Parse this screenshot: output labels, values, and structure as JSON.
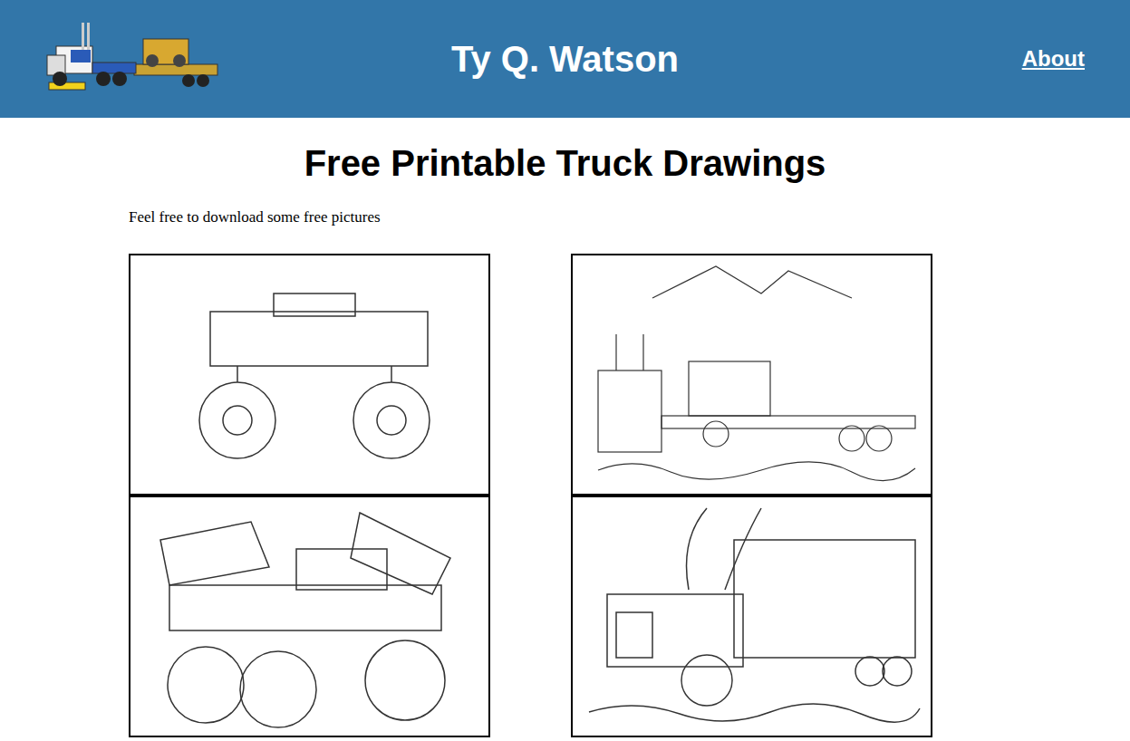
{
  "header": {
    "title": "Ty Q. Watson",
    "nav": [
      {
        "label": "About"
      }
    ]
  },
  "heading": "Free Printable Truck Drawings",
  "intro": "Feel free to download some free pictures"
}
